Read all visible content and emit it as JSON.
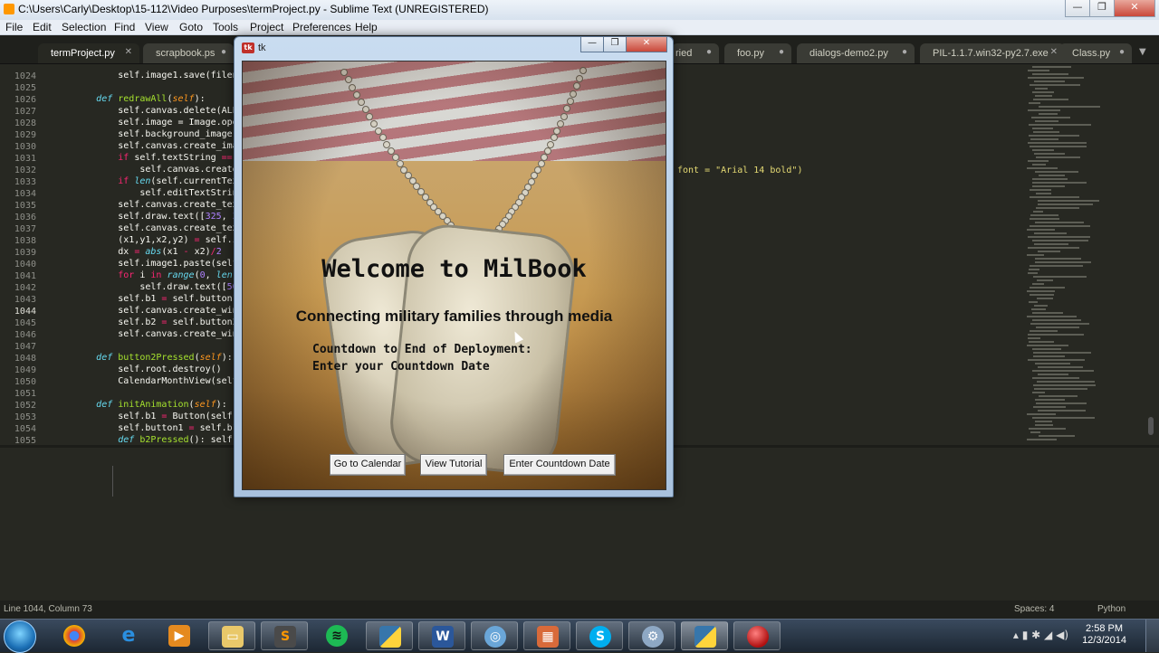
{
  "app": {
    "title": "C:\\Users\\Carly\\Desktop\\15-112\\Video Purposes\\termProject.py - Sublime Text (UNREGISTERED)"
  },
  "menu": [
    "File",
    "Edit",
    "Selection",
    "Find",
    "View",
    "Goto",
    "Tools",
    "Project",
    "Preferences",
    "Help"
  ],
  "tabs": [
    {
      "label": "termProject.py",
      "active": true
    },
    {
      "label": "scrapbook.ps",
      "active": false
    },
    {
      "label": "ried",
      "active": false
    },
    {
      "label": "foo.py",
      "active": false
    },
    {
      "label": "dialogs-demo2.py",
      "active": false
    },
    {
      "label": "PIL-1.1.7.win32-py2.7.exe",
      "active": false
    },
    {
      "label": "Class.py",
      "active": false
    }
  ],
  "editor": {
    "line_numbers": [
      "1024",
      "1025",
      "1026",
      "1027",
      "1028",
      "1029",
      "1030",
      "1031",
      "1032",
      "1033",
      "1034",
      "1035",
      "1036",
      "1037",
      "1038",
      "1039",
      "1040",
      "1041",
      "1042",
      "1043",
      "1044",
      "1045",
      "1046",
      "1047",
      "1048",
      "1049",
      "1050",
      "1051",
      "1052",
      "1053",
      "1054",
      "1055"
    ],
    "right_code_fragment": "font = \"Arial 14 bold\")"
  },
  "status": {
    "position": "Line 1044, Column 73",
    "spaces": "Spaces: 4",
    "syntax": "Python"
  },
  "tk_window": {
    "title": "tk",
    "welcome": "Welcome to MilBook",
    "tagline": "Connecting military families through media",
    "countdown_line1": "Countdown to End of Deployment:",
    "countdown_line2": "Enter your Countdown Date",
    "buttons": {
      "calendar": "Go to Calendar",
      "tutorial": "View Tutorial",
      "countdown": "Enter Countdown Date"
    }
  },
  "taskbar": {
    "icons": [
      "chrome-icon",
      "internet-explorer-icon",
      "media-player-icon",
      "explorer-folder-icon",
      "sublime-text-icon",
      "spotify-icon",
      "python-icon",
      "word-icon",
      "network-icon",
      "paint-icon",
      "skype-icon",
      "settings-icon",
      "python-idle-icon",
      "ball-icon"
    ],
    "time": "2:58 PM",
    "date": "12/3/2014"
  },
  "colors": {
    "editor_bg": "#272822",
    "keyword": "#66d9ef",
    "function": "#a6e22e",
    "string": "#e6db74",
    "number": "#ae81ff"
  }
}
